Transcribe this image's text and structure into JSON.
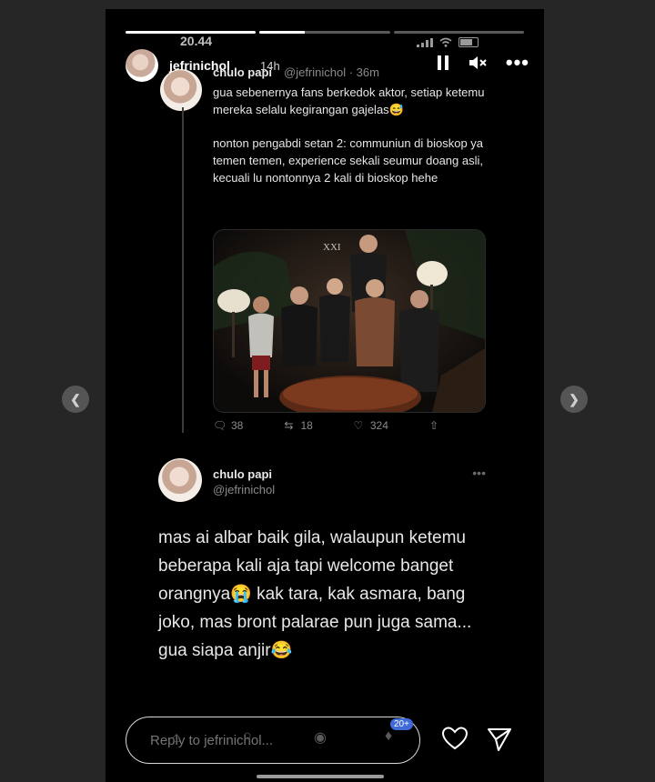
{
  "status": {
    "time": "20.44"
  },
  "story": {
    "username": "jefrinichol",
    "age": "14h",
    "progress": [
      1.0,
      0.35,
      0.0
    ]
  },
  "tweet1": {
    "name": "chulo papi",
    "handle": "@jefrinichol · 36m",
    "paragraphs": [
      "gua sebenernya fans berkedok aktor, setiap ketemu mereka selalu kegirangan gajelas😅",
      "nonton pengabdi setan 2: communiun di bioskop ya temen temen, experience sekali seumur doang asli, kecuali lu nontonnya 2 kali di bioskop hehe"
    ],
    "photo_sign": "XXI",
    "stats": {
      "replies": "38",
      "retweets": "18",
      "likes": "324"
    }
  },
  "tweet2": {
    "name": "chulo papi",
    "handle": "@jefrinichol",
    "text": "mas ai albar baik gila, walaupun ketemu beberapa kali aja tapi welcome banget orangnya😭 kak tara, kak asmara, bang joko, mas bront palarae pun juga sama... gua siapa anjir😂"
  },
  "reply": {
    "placeholder": "Reply to jefrinichol..."
  },
  "badge": "20+",
  "icons": {
    "pause": "pause-icon",
    "mute": "mute-icon",
    "more": "more-icon",
    "heart": "heart-icon",
    "send": "send-icon",
    "prev": "chevron-left-icon",
    "next": "chevron-right-icon"
  },
  "colors": {
    "background": "#000000",
    "page": "#262626",
    "badge": "#3f6bd8"
  }
}
